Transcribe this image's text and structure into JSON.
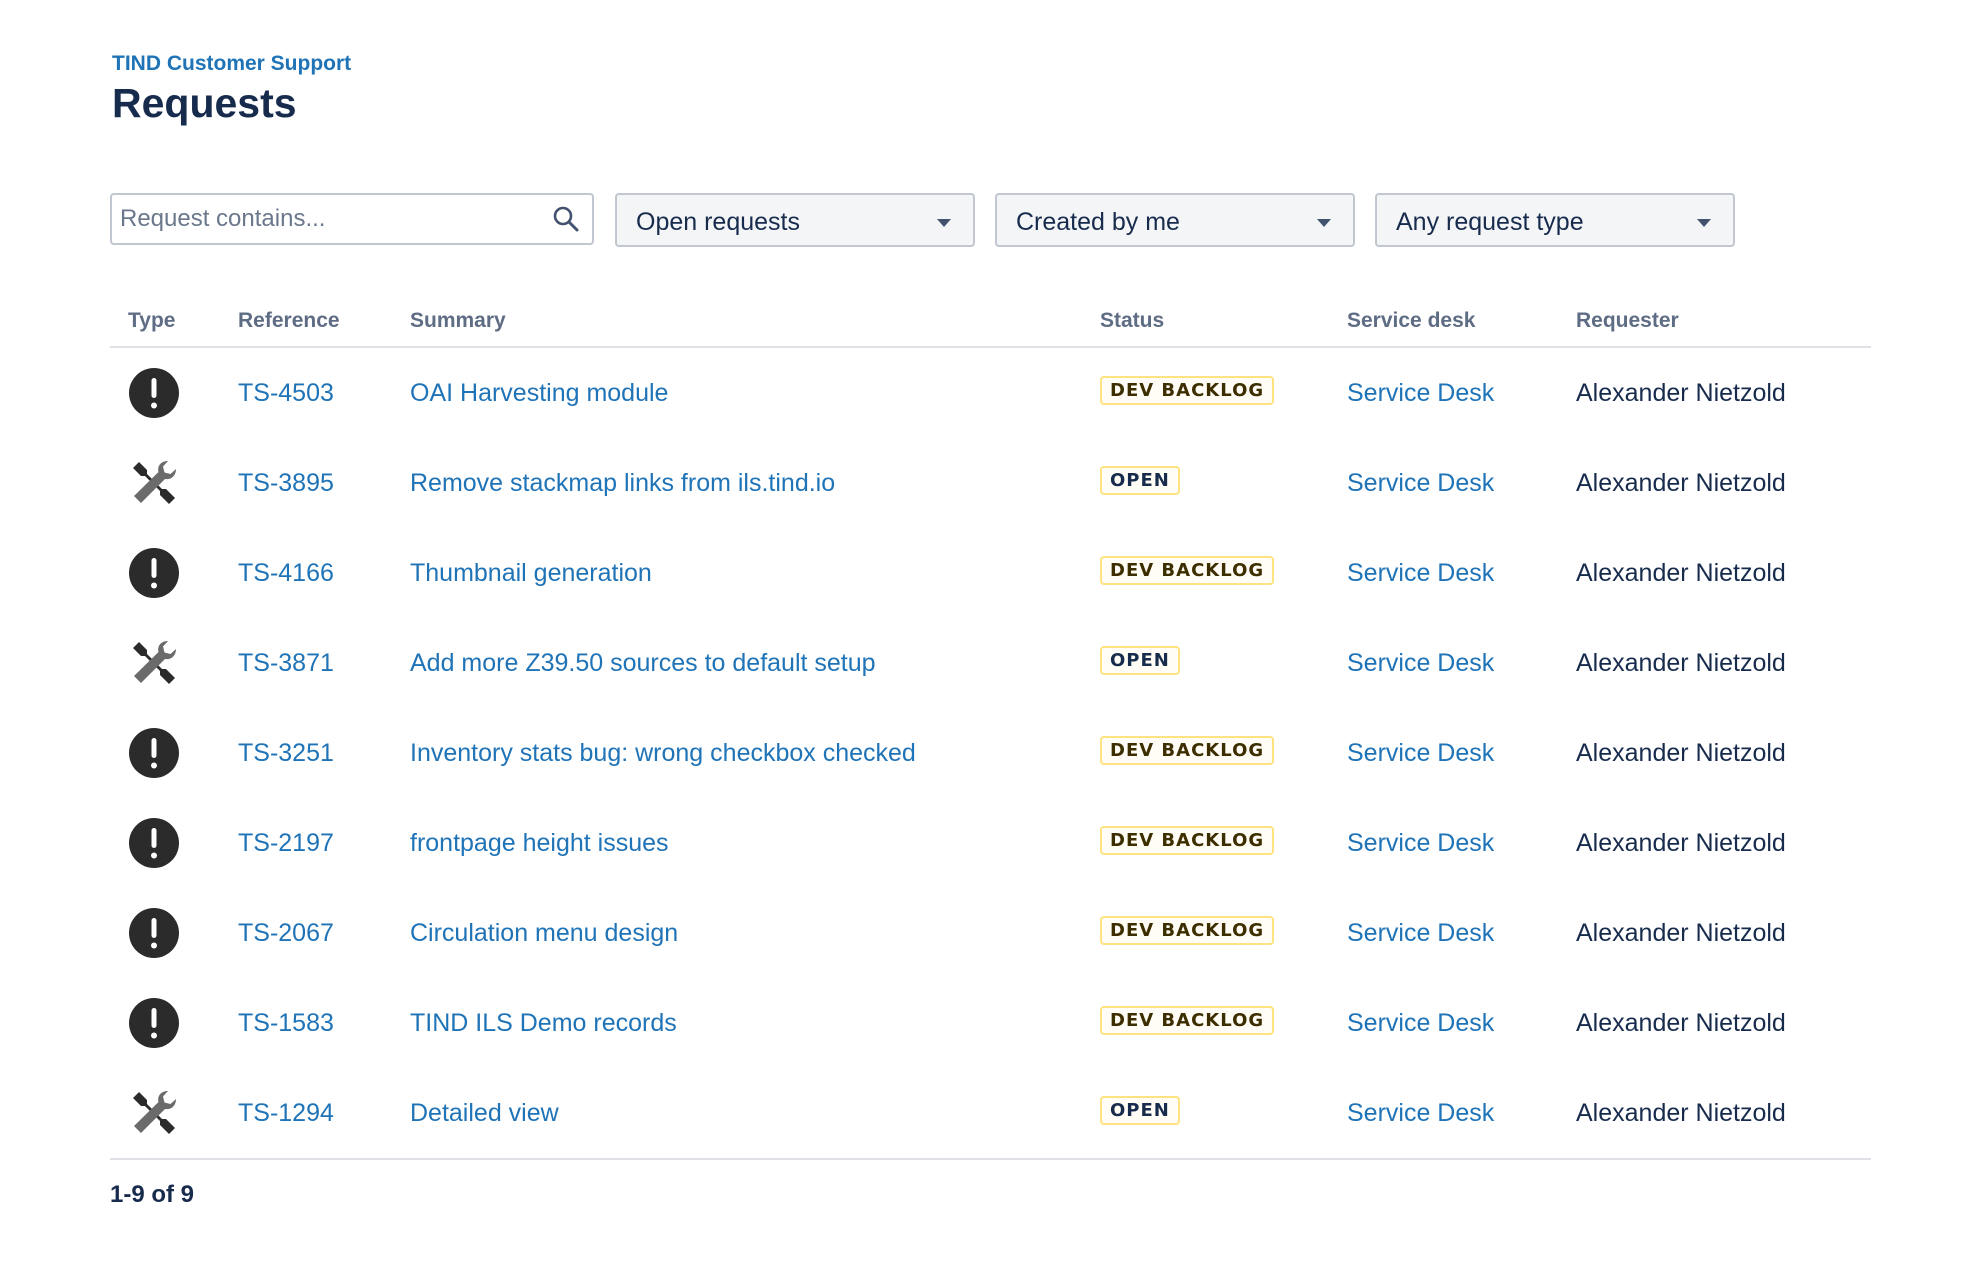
{
  "breadcrumb": "TIND Customer Support",
  "page_title": "Requests",
  "filters": {
    "search_placeholder": "Request contains...",
    "status_filter": "Open requests",
    "creator_filter": "Created by me",
    "type_filter": "Any request type"
  },
  "table": {
    "columns": [
      "Type",
      "Reference",
      "Summary",
      "Status",
      "Service desk",
      "Requester"
    ],
    "rows": [
      {
        "type_icon": "exclamation-icon",
        "reference": "TS-4503",
        "summary": "OAI Harvesting module",
        "status": "DEV BACKLOG",
        "service_desk": "Service Desk",
        "requester": "Alexander Nietzold"
      },
      {
        "type_icon": "wrench-icon",
        "reference": "TS-3895",
        "summary": "Remove stackmap links from ils.tind.io",
        "status": "OPEN",
        "service_desk": "Service Desk",
        "requester": "Alexander Nietzold"
      },
      {
        "type_icon": "exclamation-icon",
        "reference": "TS-4166",
        "summary": "Thumbnail generation",
        "status": "DEV BACKLOG",
        "service_desk": "Service Desk",
        "requester": "Alexander Nietzold"
      },
      {
        "type_icon": "wrench-icon",
        "reference": "TS-3871",
        "summary": "Add more Z39.50 sources to default setup",
        "status": "OPEN",
        "service_desk": "Service Desk",
        "requester": "Alexander Nietzold"
      },
      {
        "type_icon": "exclamation-icon",
        "reference": "TS-3251",
        "summary": "Inventory stats bug: wrong checkbox checked",
        "status": "DEV BACKLOG",
        "service_desk": "Service Desk",
        "requester": "Alexander Nietzold"
      },
      {
        "type_icon": "exclamation-icon",
        "reference": "TS-2197",
        "summary": "frontpage height issues",
        "status": "DEV BACKLOG",
        "service_desk": "Service Desk",
        "requester": "Alexander Nietzold"
      },
      {
        "type_icon": "exclamation-icon",
        "reference": "TS-2067",
        "summary": "Circulation menu design",
        "status": "DEV BACKLOG",
        "service_desk": "Service Desk",
        "requester": "Alexander Nietzold"
      },
      {
        "type_icon": "exclamation-icon",
        "reference": "TS-1583",
        "summary": "TIND ILS Demo records",
        "status": "DEV BACKLOG",
        "service_desk": "Service Desk",
        "requester": "Alexander Nietzold"
      },
      {
        "type_icon": "wrench-icon",
        "reference": "TS-1294",
        "summary": "Detailed view",
        "status": "OPEN",
        "service_desk": "Service Desk",
        "requester": "Alexander Nietzold"
      }
    ]
  },
  "pagination": "1-9 of 9",
  "colors": {
    "link": "#1f73b7",
    "text": "#172b4d",
    "lozenge_border": "#ffe380"
  }
}
